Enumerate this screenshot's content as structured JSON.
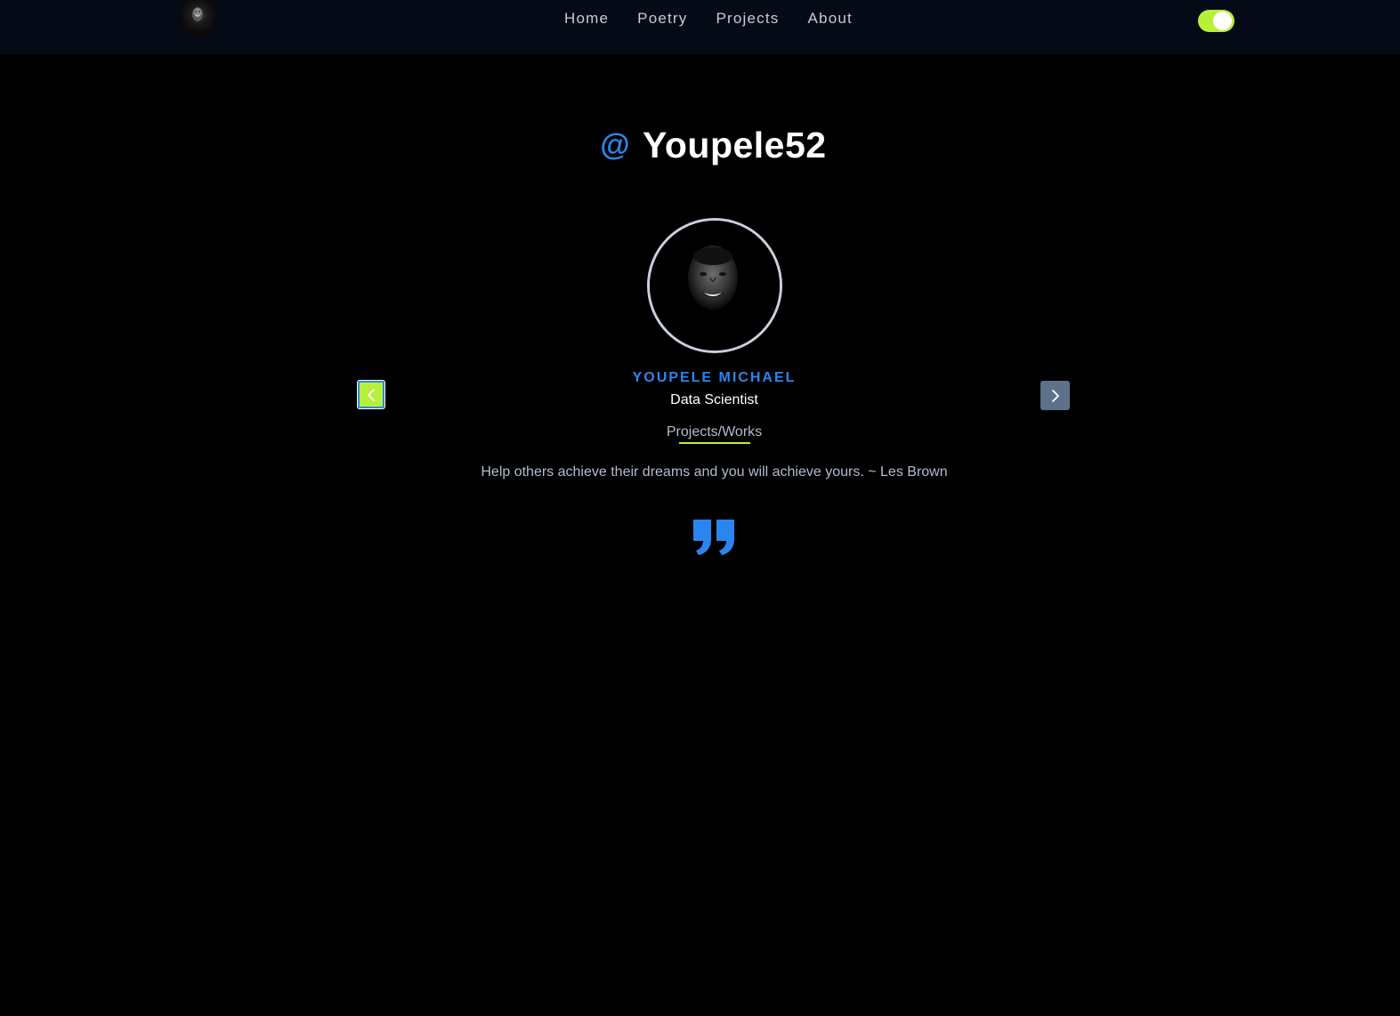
{
  "nav": {
    "logo_icon": "avatar-logo-icon",
    "links": [
      "Home",
      "Poetry",
      "Projects",
      "About"
    ],
    "theme_toggle": {
      "state": "on",
      "color": "#b6f13a"
    }
  },
  "hero": {
    "at_symbol": "@",
    "handle": "Youpele52"
  },
  "testimonial": {
    "name": "YOUPELE MICHAEL",
    "role": "Data Scientist",
    "link_label": "Projects/Works",
    "quote": "Help others achieve their dreams and you will achieve yours. ~ Les Brown",
    "quote_icon": "quote-right-icon",
    "prev_icon": "chevron-left-icon",
    "next_icon": "chevron-right-icon"
  },
  "colors": {
    "background": "#000000",
    "navbar": "#050b16",
    "accent_blue": "#2a86ee",
    "accent_green": "#b6f13a",
    "muted_text": "#b3bccb"
  }
}
